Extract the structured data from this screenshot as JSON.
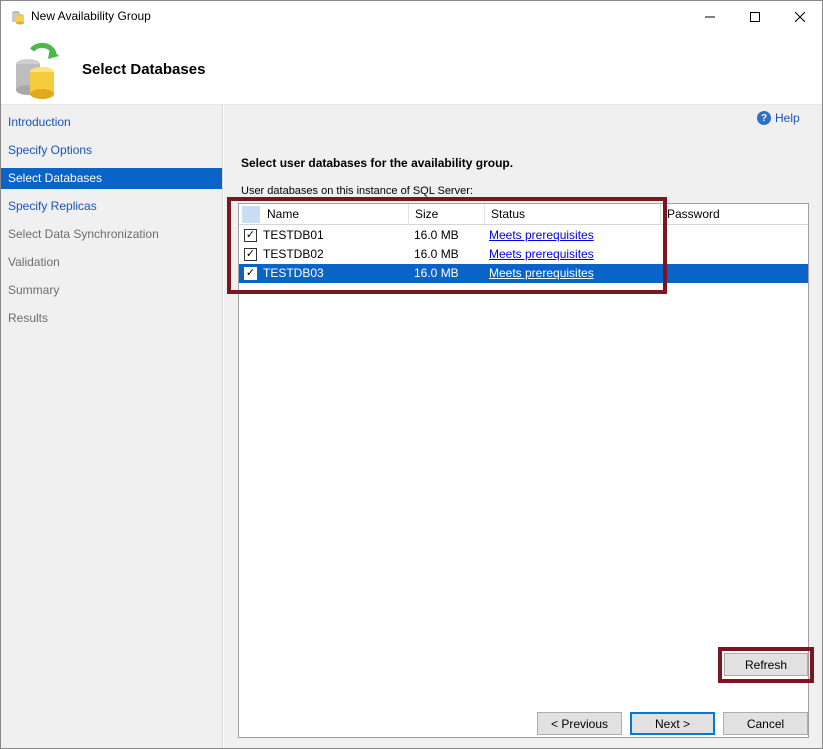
{
  "window": {
    "title": "New Availability Group",
    "controls": {
      "minimize": "—",
      "maximize": "☐",
      "close": "✕"
    }
  },
  "header": {
    "title": "Select Databases"
  },
  "nav": {
    "items": [
      {
        "label": "Introduction",
        "state": "link"
      },
      {
        "label": "Specify Options",
        "state": "link"
      },
      {
        "label": "Select Databases",
        "state": "selected"
      },
      {
        "label": "Specify Replicas",
        "state": "link"
      },
      {
        "label": "Select Data Synchronization",
        "state": "disabled"
      },
      {
        "label": "Validation",
        "state": "disabled"
      },
      {
        "label": "Summary",
        "state": "disabled"
      },
      {
        "label": "Results",
        "state": "disabled"
      }
    ]
  },
  "content": {
    "help_label": "Help",
    "help_icon": "?",
    "instruction": "Select user databases for the availability group.",
    "list_label": "User databases on this instance of SQL Server:",
    "columns": [
      "Name",
      "Size",
      "Status",
      "Password"
    ],
    "rows": [
      {
        "checked": true,
        "check_glyph": "✓",
        "name": "TESTDB01",
        "size": "16.0 MB",
        "status": "Meets prerequisites",
        "password": ""
      },
      {
        "checked": true,
        "check_glyph": "✓",
        "name": "TESTDB02",
        "size": "16.0 MB",
        "status": "Meets prerequisites",
        "password": ""
      },
      {
        "checked": true,
        "check_glyph": "✓",
        "name": "TESTDB03",
        "size": "16.0 MB",
        "status": "Meets prerequisites",
        "password": "",
        "selected": true
      }
    ]
  },
  "buttons": {
    "refresh": "Refresh",
    "previous": "< Previous",
    "next": "Next >",
    "cancel": "Cancel"
  },
  "colors": {
    "selection": "#0a64c8",
    "highlight_box": "#7b1520",
    "link": "#1a53b5"
  }
}
